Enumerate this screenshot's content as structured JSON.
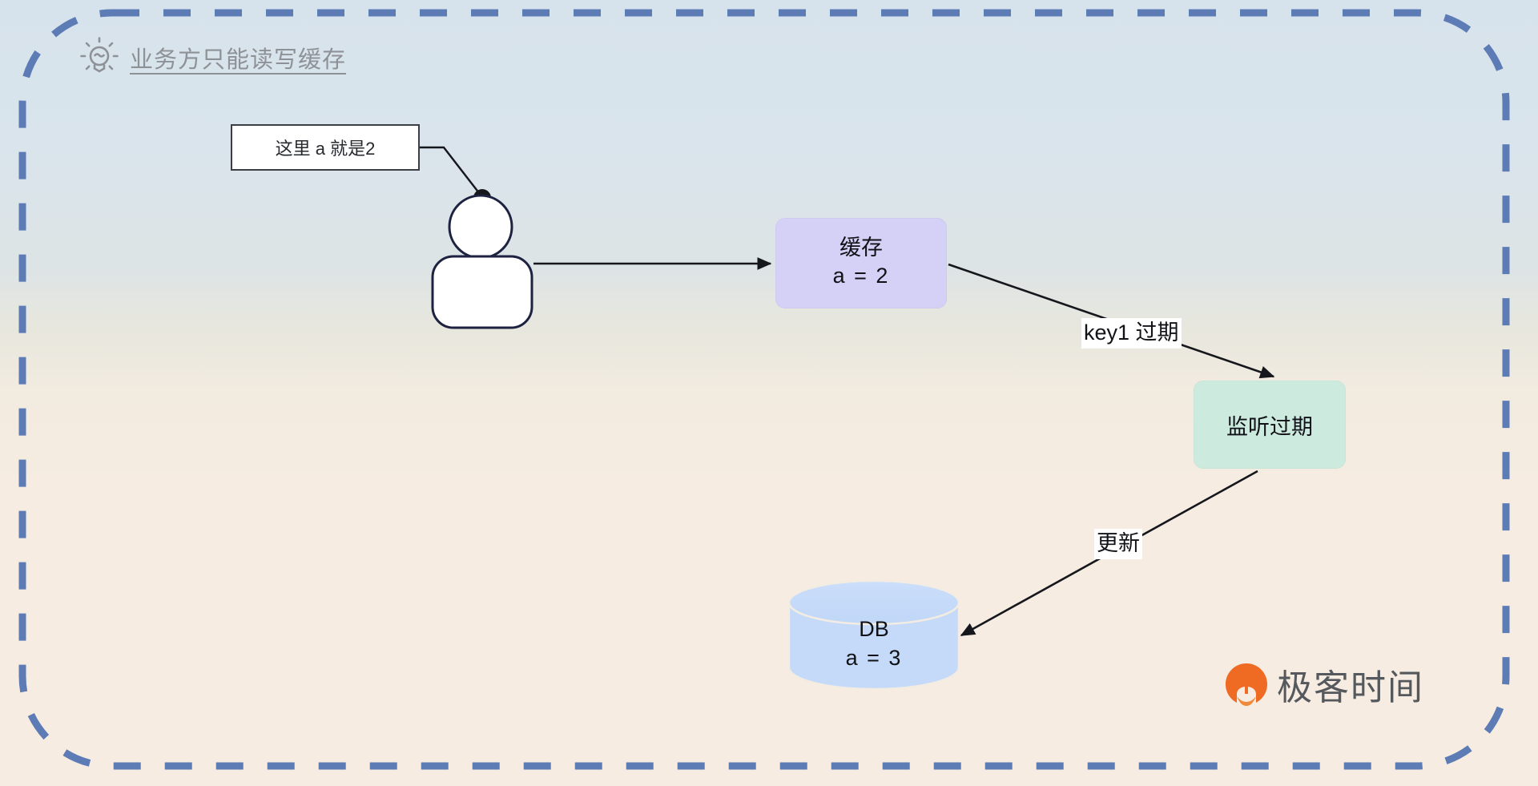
{
  "diagram": {
    "title": "业务方只能读写缓存",
    "title_icon": "lightbulb-icon",
    "note": {
      "text": "这里 a 就是2"
    },
    "actor": {
      "name": "user-actor"
    },
    "nodes": [
      {
        "id": "cache",
        "line1": "缓存",
        "line2": "a = 2",
        "color": "#d5d0f5",
        "shape": "rounded-rect"
      },
      {
        "id": "listener",
        "line1": "监听过期",
        "color": "#cdeade",
        "shape": "rounded-rect"
      },
      {
        "id": "db",
        "line1": "DB",
        "line2": "a = 3",
        "color": "#c4daf8",
        "shape": "cylinder"
      }
    ],
    "edges": [
      {
        "id": "actor-to-cache",
        "label": ""
      },
      {
        "id": "cache-to-listener",
        "label": "key1 过期"
      },
      {
        "id": "listener-to-db",
        "label": "更新"
      }
    ],
    "border": {
      "style": "dashed",
      "color": "#5d7cb5"
    },
    "background": {
      "top_color": "#d7e3ec",
      "bottom_color": "#f7ece1"
    }
  },
  "brand": {
    "name": "极客时间",
    "mark": "geektime-logo-icon",
    "mark_color": "#ef6a23"
  }
}
